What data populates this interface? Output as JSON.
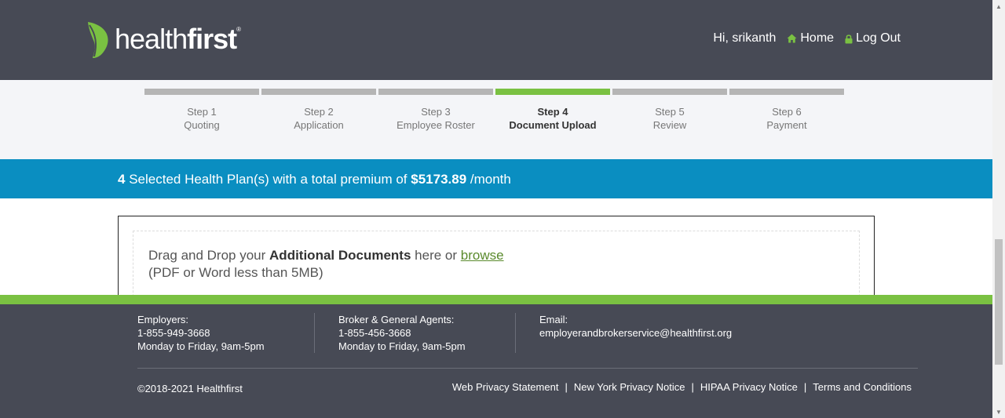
{
  "header": {
    "logo_light": "health",
    "logo_bold": "first",
    "logo_reg": "®",
    "greeting": "Hi, srikanth",
    "home_label": "Home",
    "logout_label": "Log Out",
    "accent": "#7ac142",
    "background": "#474a55"
  },
  "steps": [
    {
      "num": "Step 1",
      "name": "Quoting"
    },
    {
      "num": "Step 2",
      "name": "Application"
    },
    {
      "num": "Step 3",
      "name": "Employee Roster"
    },
    {
      "num": "Step 4",
      "name": "Document Upload"
    },
    {
      "num": "Step 5",
      "name": "Review"
    },
    {
      "num": "Step 6",
      "name": "Payment"
    }
  ],
  "active_step": 4,
  "banner": {
    "count": "4",
    "middle": " Selected Health Plan(s) with a total premium of ",
    "amount": "$5173.89",
    "suffix": " /month",
    "color": "#0a8ec1"
  },
  "upload": {
    "prefix": "Drag and Drop your ",
    "bold": "Additional Documents",
    "middle": " here or ",
    "browse": "browse",
    "hint": "(PDF or Word less than 5MB)"
  },
  "footer": {
    "employers": {
      "label": "Employers:",
      "phone": "1-855-949-3668",
      "hours": "Monday to Friday, 9am-5pm"
    },
    "brokers": {
      "label": "Broker & General Agents:",
      "phone": "1-855-456-3668",
      "hours": "Monday to Friday, 9am-5pm"
    },
    "email": {
      "label": "Email:",
      "address": "employerandbrokerservice@healthfirst.org"
    },
    "copyright": "©2018-2021 Healthfirst",
    "links": [
      "Web Privacy Statement",
      "New York Privacy Notice",
      "HIPAA Privacy Notice",
      "Terms and Conditions"
    ],
    "separator": "|"
  }
}
